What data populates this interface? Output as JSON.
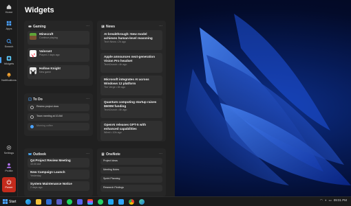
{
  "colors": {
    "accent": "#4aa3ff",
    "power": "#c42b1c",
    "panel": "#202020",
    "card": "#262626"
  },
  "rail": {
    "items": [
      {
        "label": "Home",
        "icon": "home-icon"
      },
      {
        "label": "Apps",
        "icon": "apps-icon"
      },
      {
        "label": "Search",
        "icon": "search-icon"
      },
      {
        "label": "Widgets",
        "icon": "widgets-icon"
      },
      {
        "label": "Notifications",
        "icon": "bell-icon"
      }
    ],
    "bottom": [
      {
        "label": "Settings",
        "icon": "gear-icon"
      },
      {
        "label": "Profile",
        "icon": "person-icon"
      }
    ],
    "power_label": "Power"
  },
  "panel": {
    "title": "Widgets",
    "gaming": {
      "title": "Gaming",
      "items": [
        {
          "name": "Minecraft",
          "status": "Continue playing"
        },
        {
          "name": "Valorant",
          "status": "Played 2 days ago"
        },
        {
          "name": "Hollow Knight",
          "status": "New game"
        }
      ]
    },
    "news": {
      "title": "News",
      "items": [
        {
          "headline": "AI breakthrough: New model achieves human-level reasoning",
          "source": "Tech News • 2h ago"
        },
        {
          "headline": "Apple announces next-generation Vision Pro headset",
          "source": "TechCrunch • 4h ago"
        },
        {
          "headline": "Microsoft integrates AI across Windows 12 platform",
          "source": "The Verge • 6h ago"
        },
        {
          "headline": "Quantum computing startup raises $500M funding",
          "source": "TechCrunch • 8h ago"
        },
        {
          "headline": "OpenAI releases GPT-5 with enhanced capabilities",
          "source": "Wired • 10h ago"
        }
      ]
    },
    "todo": {
      "title": "To Do",
      "items": [
        {
          "text": "Review project docs"
        },
        {
          "text": "Team meeting at 10 AM"
        },
        {
          "text": "Morning coffee"
        }
      ]
    },
    "outlook": {
      "title": "Outlook",
      "items": [
        {
          "subject": "Q4 Project Review Meeting",
          "meta": "10:00 AM"
        },
        {
          "subject": "New Campaign Launch",
          "meta": "Yesterday"
        },
        {
          "subject": "System Maintenance Notice",
          "meta": "2 days ago"
        }
      ]
    },
    "onenote": {
      "title": "OneNote",
      "items": [
        {
          "title": "Project Ideas"
        },
        {
          "title": "Meeting Notes"
        },
        {
          "title": "Sprint Planning"
        },
        {
          "title": "Research Findings"
        }
      ]
    }
  },
  "taskbar": {
    "start_label": "Start",
    "apps": [
      "edge-icon",
      "explorer-icon",
      "store-icon",
      "teams-icon",
      "spotify-icon",
      "discord-icon",
      "figma-icon",
      "whatsapp-icon",
      "vscode-icon",
      "photoshop-icon",
      "chrome-icon",
      "edge-dev-icon"
    ],
    "clock": "09:01 PM"
  }
}
